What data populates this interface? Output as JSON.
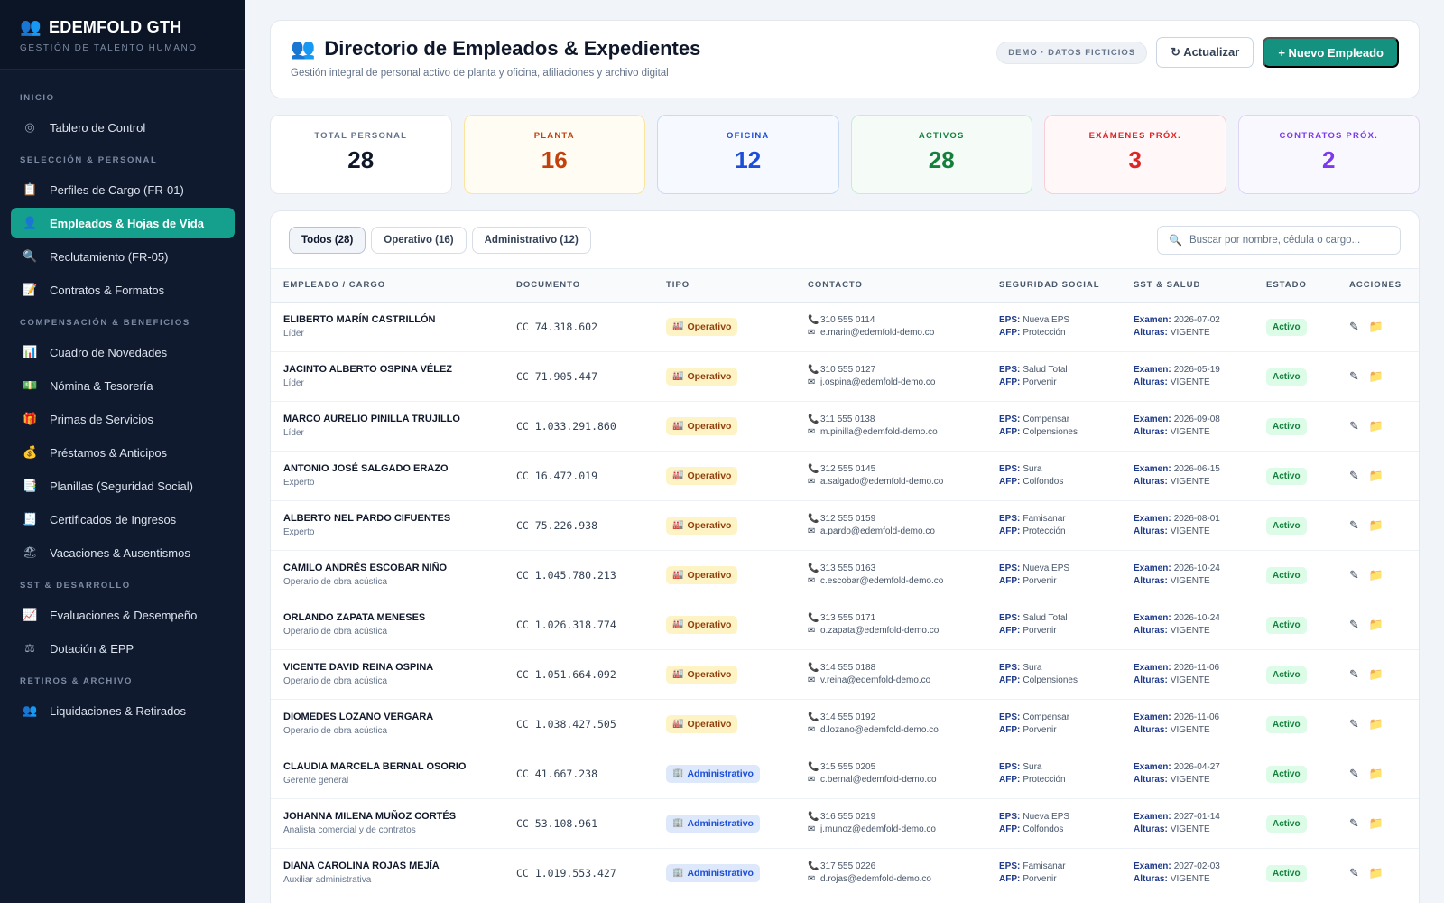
{
  "brand": {
    "title": "EDEMFOLD GTH",
    "subtitle": "GESTIÓN DE TALENTO HUMANO",
    "icon": "users-icon"
  },
  "sidebar": {
    "sections": [
      {
        "title": "INICIO",
        "items": [
          {
            "label": "Tablero de Control",
            "icon": "target-icon"
          }
        ]
      },
      {
        "title": "SELECCIÓN & PERSONAL",
        "items": [
          {
            "label": "Perfiles de Cargo (FR-01)",
            "icon": "clipboard-icon"
          },
          {
            "label": "Empleados & Hojas de Vida",
            "icon": "user-icon",
            "active": true
          },
          {
            "label": "Reclutamiento (FR-05)",
            "icon": "search-icon"
          },
          {
            "label": "Contratos & Formatos",
            "icon": "memo-icon"
          }
        ]
      },
      {
        "title": "COMPENSACIÓN & BENEFICIOS",
        "items": [
          {
            "label": "Cuadro de Novedades",
            "icon": "bar-chart-icon"
          },
          {
            "label": "Nómina & Tesorería",
            "icon": "money-icon"
          },
          {
            "label": "Primas de Servicios",
            "icon": "gift-icon"
          },
          {
            "label": "Préstamos & Anticipos",
            "icon": "money-bag-icon"
          },
          {
            "label": "Planillas (Seguridad Social)",
            "icon": "document-icon"
          },
          {
            "label": "Certificados de Ingresos",
            "icon": "receipt-icon"
          },
          {
            "label": "Vacaciones & Ausentismos",
            "icon": "beach-icon"
          }
        ]
      },
      {
        "title": "SST & DESARROLLO",
        "items": [
          {
            "label": "Evaluaciones & Desempeño",
            "icon": "trend-chart-icon"
          },
          {
            "label": "Dotación & EPP",
            "icon": "scale-icon"
          }
        ]
      },
      {
        "title": "RETIROS & ARCHIVO",
        "items": [
          {
            "label": "Liquidaciones & Retirados",
            "icon": "users-icon"
          }
        ]
      }
    ]
  },
  "header": {
    "title": "Directorio de Empleados & Expedientes",
    "subtitle": "Gestión integral de personal activo de planta y oficina, afiliaciones y archivo digital",
    "demo_badge": "DEMO · DATOS FICTICIOS",
    "refresh_label": "↻ Actualizar",
    "new_label": "+ Nuevo Empleado"
  },
  "kpis": [
    {
      "label": "TOTAL PERSONAL",
      "value": "28",
      "color": "#0f172a",
      "bg": "#ffffff",
      "border": "#e3e8ef",
      "label_color": "#64748b"
    },
    {
      "label": "PLANTA",
      "value": "16",
      "color": "#c2410c",
      "bg": "#fffdf3",
      "border": "#fbe3a0",
      "label_color": "#c2410c"
    },
    {
      "label": "OFICINA",
      "value": "12",
      "color": "#1d4ed8",
      "bg": "#f6f9ff",
      "border": "#c9daf5",
      "label_color": "#1d4ed8"
    },
    {
      "label": "ACTIVOS",
      "value": "28",
      "color": "#15803d",
      "bg": "#f5fcf7",
      "border": "#c8ecd3",
      "label_color": "#15803d"
    },
    {
      "label": "EXÁMENES PRÓX.",
      "value": "3",
      "color": "#dc2626",
      "bg": "#fff7f8",
      "border": "#f8cfd4",
      "label_color": "#dc2626"
    },
    {
      "label": "CONTRATOS PRÓX.",
      "value": "2",
      "color": "#7c3aed",
      "bg": "#faf8ff",
      "border": "#ded5f6",
      "label_color": "#7c3aed"
    }
  ],
  "filters": [
    {
      "label": "Todos (28)",
      "active": true
    },
    {
      "label": "Operativo (16)"
    },
    {
      "label": "Administrativo (12)"
    }
  ],
  "search": {
    "placeholder": "Buscar por nombre, cédula o cargo..."
  },
  "table": {
    "columns": [
      "EMPLEADO / CARGO",
      "DOCUMENTO",
      "TIPO",
      "CONTACTO",
      "SEGURIDAD SOCIAL",
      "SST & SALUD",
      "ESTADO",
      "ACCIONES"
    ],
    "labels": {
      "eps": "EPS:",
      "afp": "AFP:",
      "examen": "Examen:",
      "alturas": "Alturas:"
    },
    "rows": [
      {
        "name": "ELIBERTO MARÍN CASTRILLÓN",
        "role": "Líder",
        "doc": "CC 74.318.602",
        "tipo": "Operativo",
        "tipo_icon": "factory-icon",
        "phone": "310 555 0114",
        "email": "e.marin@edemfold-demo.co",
        "eps": "Nueva EPS",
        "afp": "Protección",
        "examen": "2026-07-02",
        "alturas": "VIGENTE",
        "estado": "Activo"
      },
      {
        "name": "JACINTO ALBERTO OSPINA VÉLEZ",
        "role": "Líder",
        "doc": "CC 71.905.447",
        "tipo": "Operativo",
        "tipo_icon": "factory-icon",
        "phone": "310 555 0127",
        "email": "j.ospina@edemfold-demo.co",
        "eps": "Salud Total",
        "afp": "Porvenir",
        "examen": "2026-05-19",
        "alturas": "VIGENTE",
        "estado": "Activo"
      },
      {
        "name": "MARCO AURELIO PINILLA TRUJILLO",
        "role": "Líder",
        "doc": "CC 1.033.291.860",
        "tipo": "Operativo",
        "tipo_icon": "factory-icon",
        "phone": "311 555 0138",
        "email": "m.pinilla@edemfold-demo.co",
        "eps": "Compensar",
        "afp": "Colpensiones",
        "examen": "2026-09-08",
        "alturas": "VIGENTE",
        "estado": "Activo"
      },
      {
        "name": "ANTONIO JOSÉ SALGADO ERAZO",
        "role": "Experto",
        "doc": "CC 16.472.019",
        "tipo": "Operativo",
        "tipo_icon": "factory-icon",
        "phone": "312 555 0145",
        "email": "a.salgado@edemfold-demo.co",
        "eps": "Sura",
        "afp": "Colfondos",
        "examen": "2026-06-15",
        "alturas": "VIGENTE",
        "estado": "Activo"
      },
      {
        "name": "ALBERTO NEL PARDO CIFUENTES",
        "role": "Experto",
        "doc": "CC 75.226.938",
        "tipo": "Operativo",
        "tipo_icon": "factory-icon",
        "phone": "312 555 0159",
        "email": "a.pardo@edemfold-demo.co",
        "eps": "Famisanar",
        "afp": "Protección",
        "examen": "2026-08-01",
        "alturas": "VIGENTE",
        "estado": "Activo"
      },
      {
        "name": "CAMILO ANDRÉS ESCOBAR NIÑO",
        "role": "Operario de obra acústica",
        "doc": "CC 1.045.780.213",
        "tipo": "Operativo",
        "tipo_icon": "factory-icon",
        "phone": "313 555 0163",
        "email": "c.escobar@edemfold-demo.co",
        "eps": "Nueva EPS",
        "afp": "Porvenir",
        "examen": "2026-10-24",
        "alturas": "VIGENTE",
        "estado": "Activo"
      },
      {
        "name": "ORLANDO ZAPATA MENESES",
        "role": "Operario de obra acústica",
        "doc": "CC 1.026.318.774",
        "tipo": "Operativo",
        "tipo_icon": "factory-icon",
        "phone": "313 555 0171",
        "email": "o.zapata@edemfold-demo.co",
        "eps": "Salud Total",
        "afp": "Porvenir",
        "examen": "2026-10-24",
        "alturas": "VIGENTE",
        "estado": "Activo"
      },
      {
        "name": "VICENTE DAVID REINA OSPINA",
        "role": "Operario de obra acústica",
        "doc": "CC 1.051.664.092",
        "tipo": "Operativo",
        "tipo_icon": "factory-icon",
        "phone": "314 555 0188",
        "email": "v.reina@edemfold-demo.co",
        "eps": "Sura",
        "afp": "Colpensiones",
        "examen": "2026-11-06",
        "alturas": "VIGENTE",
        "estado": "Activo"
      },
      {
        "name": "DIOMEDES LOZANO VERGARA",
        "role": "Operario de obra acústica",
        "doc": "CC 1.038.427.505",
        "tipo": "Operativo",
        "tipo_icon": "factory-icon",
        "phone": "314 555 0192",
        "email": "d.lozano@edemfold-demo.co",
        "eps": "Compensar",
        "afp": "Porvenir",
        "examen": "2026-11-06",
        "alturas": "VIGENTE",
        "estado": "Activo"
      },
      {
        "name": "CLAUDIA MARCELA BERNAL OSORIO",
        "role": "Gerente general",
        "doc": "CC 41.667.238",
        "tipo": "Administrativo",
        "tipo_icon": "office-building-icon",
        "phone": "315 555 0205",
        "email": "c.bernal@edemfold-demo.co",
        "eps": "Sura",
        "afp": "Protección",
        "examen": "2026-04-27",
        "alturas": "VIGENTE",
        "estado": "Activo"
      },
      {
        "name": "JOHANNA MILENA MUÑOZ CORTÉS",
        "role": "Analista comercial y de contratos",
        "doc": "CC 53.108.961",
        "tipo": "Administrativo",
        "tipo_icon": "office-building-icon",
        "phone": "316 555 0219",
        "email": "j.munoz@edemfold-demo.co",
        "eps": "Nueva EPS",
        "afp": "Colfondos",
        "examen": "2027-01-14",
        "alturas": "VIGENTE",
        "estado": "Activo"
      },
      {
        "name": "DIANA CAROLINA ROJAS MEJÍA",
        "role": "Auxiliar administrativa",
        "doc": "CC 1.019.553.427",
        "tipo": "Administrativo",
        "tipo_icon": "office-building-icon",
        "phone": "317 555 0226",
        "email": "d.rojas@edemfold-demo.co",
        "eps": "Famisanar",
        "afp": "Porvenir",
        "examen": "2027-02-03",
        "alturas": "VIGENTE",
        "estado": "Activo"
      }
    ]
  }
}
